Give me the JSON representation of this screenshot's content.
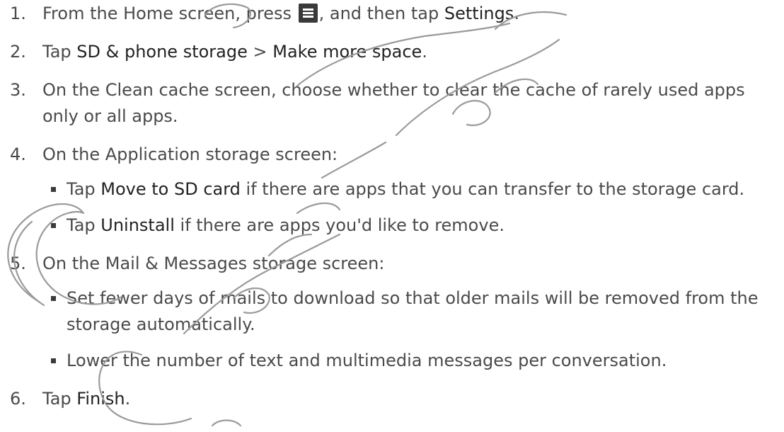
{
  "steps": [
    {
      "num": "1.",
      "pre": "From the Home screen, press ",
      "icon": "menu-icon",
      "mid": ", and then tap ",
      "bold": "Settings",
      "post": "."
    },
    {
      "num": "2.",
      "pre": "Tap ",
      "bold1": "SD & phone storage",
      "mid": " > ",
      "bold2": "Make more space",
      "post": "."
    },
    {
      "num": "3.",
      "text": "On the Clean cache screen, choose whether to clear the cache of rarely used apps only or all apps."
    },
    {
      "num": "4.",
      "text": "On the Application storage screen:",
      "subitems": [
        {
          "pre": "Tap ",
          "bold": "Move to SD card",
          "post": " if there are apps that you can transfer to the storage card."
        },
        {
          "pre": "Tap ",
          "bold": "Uninstall",
          "post": " if there are apps you'd like to remove."
        }
      ]
    },
    {
      "num": "5.",
      "text": "On the Mail & Messages storage screen:",
      "subitems": [
        {
          "text": "Set fewer days of mails to download so that older mails will be removed from the storage automatically."
        },
        {
          "text": "Lower the number of text and multimedia messages per conversation."
        }
      ]
    },
    {
      "num": "6.",
      "pre": "Tap ",
      "bold": "Finish",
      "post": "."
    }
  ],
  "colors": {
    "text": "#4a4a4a",
    "emphasis": "#222222",
    "watermark": "#b0b0b0"
  }
}
